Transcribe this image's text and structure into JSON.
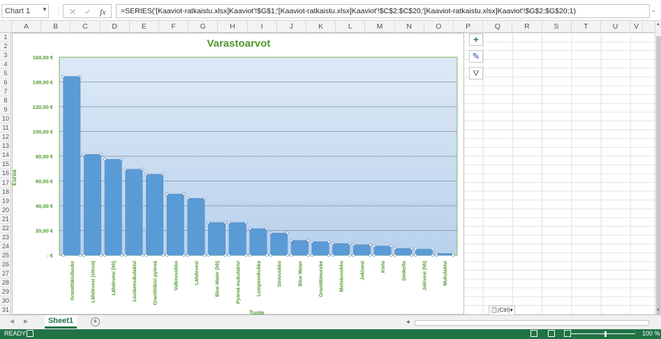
{
  "formula_bar": {
    "name_box": "Chart 1",
    "cancel_icon": "✕",
    "enter_icon": "✓",
    "fx_label": "fx",
    "formula": "=SERIES('[Kaaviot-ratkaistu.xlsx]Kaaviot'!$G$1;'[Kaaviot-ratkaistu.xlsx]Kaaviot'!$C$2:$C$20;'[Kaaviot-ratkaistu.xlsx]Kaaviot'!$G$2:$G$20;1)"
  },
  "columns": [
    "A",
    "B",
    "C",
    "D",
    "E",
    "F",
    "G",
    "H",
    "I",
    "J",
    "K",
    "L",
    "M",
    "N",
    "O",
    "P",
    "Q",
    "R",
    "S",
    "T",
    "U",
    "V"
  ],
  "rows": [
    "1",
    "2",
    "3",
    "4",
    "5",
    "6",
    "7",
    "8",
    "9",
    "10",
    "11",
    "12",
    "13",
    "14",
    "15",
    "16",
    "17",
    "18",
    "19",
    "20",
    "21",
    "22",
    "23",
    "24",
    "25",
    "26",
    "27",
    "28",
    "29",
    "30",
    "31"
  ],
  "chart_buttons": [
    {
      "name": "chart-elements-button",
      "glyph": "+",
      "color": "#217346"
    },
    {
      "name": "chart-styles-button",
      "glyph": "✎",
      "color": "#2f5f9a"
    },
    {
      "name": "chart-filters-button",
      "glyph": "⛛",
      "color": "#555"
    }
  ],
  "paste_options": "(Ctrl)",
  "sheet_tab": "Sheet1",
  "add_sheet": "+",
  "status": "READY",
  "zoom": "100 %",
  "chart_data": {
    "type": "bar",
    "title": "Varastoarvot",
    "xlabel": "Tuote",
    "ylabel": "Euroa",
    "ylim": [
      0,
      160
    ],
    "ytick_labels": [
      "-  €",
      "20,00 €",
      "40,00 €",
      "60,00 €",
      "80,00 €",
      "100,00 €",
      "120,00 €",
      "140,00 €",
      "160,00 €"
    ],
    "grid": true,
    "bar_color": "#5b9bd5",
    "plot_bg": "#c9dcf0",
    "categories": [
      "Graniittikiviluuke",
      "Lähdevesi (sitrus)",
      "Lähdevesi (hh)",
      "Liuskemukulakivi",
      "Graniittikivi pyöreä",
      "Valkovuokko",
      "Lähdevesi",
      "Blue Water (hh)",
      "Pyöreä mukulakivi",
      "Lumpeenkukka",
      "Sinivuokko",
      "Blue Water",
      "Graniittimurske",
      "Metsävuokko",
      "Jokivesi",
      "Kielo",
      "Sinikello",
      "Jokivesi (hh)",
      "Mukulakivi"
    ],
    "values": [
      144.5,
      81.5,
      77.5,
      69.5,
      65.5,
      49.5,
      46,
      26.5,
      26.5,
      21.5,
      18,
      12,
      11,
      9.5,
      8.5,
      7.5,
      5.5,
      5,
      1.5
    ]
  }
}
